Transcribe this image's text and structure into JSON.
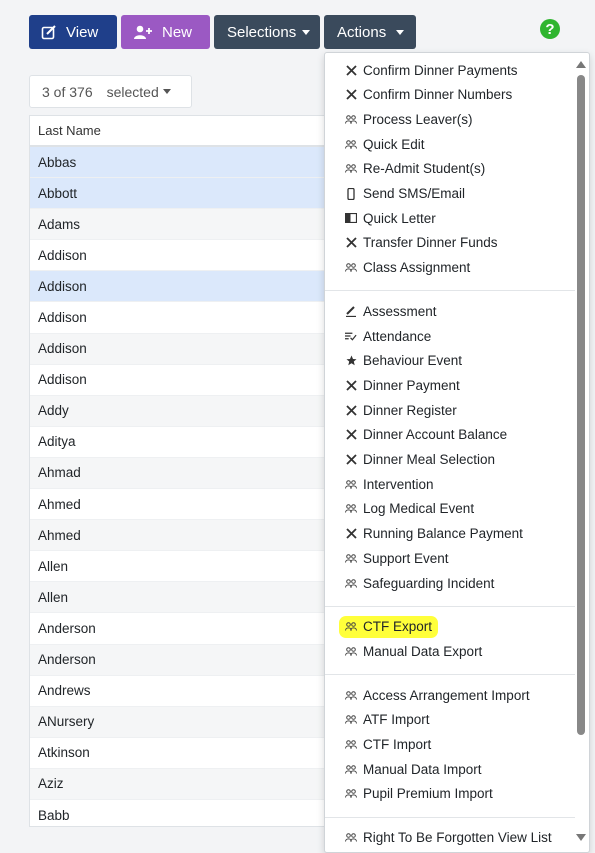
{
  "toolbar": {
    "view_label": "View",
    "new_label": "New",
    "selections_label": "Selections",
    "actions_label": "Actions",
    "help_label": "?"
  },
  "selection": {
    "count": "3 of 376",
    "word": "selected"
  },
  "table": {
    "header": "Last Name",
    "rows": [
      {
        "name": "Abbas",
        "selected": true
      },
      {
        "name": "Abbott",
        "selected": true
      },
      {
        "name": "Adams",
        "selected": false
      },
      {
        "name": "Addison",
        "selected": false
      },
      {
        "name": "Addison",
        "selected": true
      },
      {
        "name": "Addison",
        "selected": false
      },
      {
        "name": "Addison",
        "selected": false
      },
      {
        "name": "Addison",
        "selected": false
      },
      {
        "name": "Addy",
        "selected": false
      },
      {
        "name": "Aditya",
        "selected": false
      },
      {
        "name": "Ahmad",
        "selected": false
      },
      {
        "name": "Ahmed",
        "selected": false
      },
      {
        "name": "Ahmed",
        "selected": false
      },
      {
        "name": "Allen",
        "selected": false
      },
      {
        "name": "Allen",
        "selected": false
      },
      {
        "name": "Anderson",
        "selected": false
      },
      {
        "name": "Anderson",
        "selected": false
      },
      {
        "name": "Andrews",
        "selected": false
      },
      {
        "name": "ANursery",
        "selected": false
      },
      {
        "name": "Atkinson",
        "selected": false
      },
      {
        "name": "Aziz",
        "selected": false
      },
      {
        "name": "Babb",
        "selected": false
      }
    ]
  },
  "actions_menu": {
    "groups": [
      [
        {
          "label": "Confirm Dinner Payments",
          "icon": "cutlery-icon"
        },
        {
          "label": "Confirm Dinner Numbers",
          "icon": "cutlery-icon"
        },
        {
          "label": "Process Leaver(s)",
          "icon": "users-icon"
        },
        {
          "label": "Quick Edit",
          "icon": "users-icon"
        },
        {
          "label": "Re-Admit Student(s)",
          "icon": "users-icon"
        },
        {
          "label": "Send SMS/Email",
          "icon": "phone-icon"
        },
        {
          "label": "Quick Letter",
          "icon": "letter-icon"
        },
        {
          "label": "Transfer Dinner Funds",
          "icon": "cutlery-icon"
        },
        {
          "label": "Class Assignment",
          "icon": "users-icon"
        }
      ],
      [
        {
          "label": "Assessment",
          "icon": "pen-icon"
        },
        {
          "label": "Attendance",
          "icon": "checklist-icon"
        },
        {
          "label": "Behaviour Event",
          "icon": "star-icon"
        },
        {
          "label": "Dinner Payment",
          "icon": "cutlery-icon"
        },
        {
          "label": "Dinner Register",
          "icon": "cutlery-icon"
        },
        {
          "label": "Dinner Account Balance",
          "icon": "cutlery-icon"
        },
        {
          "label": "Dinner Meal Selection",
          "icon": "cutlery-icon"
        },
        {
          "label": "Intervention",
          "icon": "users-icon"
        },
        {
          "label": "Log Medical Event",
          "icon": "users-icon"
        },
        {
          "label": "Running Balance Payment",
          "icon": "cutlery-icon"
        },
        {
          "label": "Support Event",
          "icon": "users-icon"
        },
        {
          "label": "Safeguarding Incident",
          "icon": "users-icon"
        }
      ],
      [
        {
          "label": "CTF Export",
          "icon": "users-icon",
          "highlighted": true
        },
        {
          "label": "Manual Data Export",
          "icon": "users-icon"
        }
      ],
      [
        {
          "label": "Access Arrangement Import",
          "icon": "users-icon"
        },
        {
          "label": "ATF Import",
          "icon": "users-icon"
        },
        {
          "label": "CTF Import",
          "icon": "users-icon"
        },
        {
          "label": "Manual Data Import",
          "icon": "users-icon"
        },
        {
          "label": "Pupil Premium Import",
          "icon": "users-icon"
        }
      ],
      [
        {
          "label": "Right To Be Forgotten View List",
          "icon": "users-icon"
        }
      ]
    ]
  },
  "colors": {
    "view_button": "#1f3f8a",
    "new_button": "#9b59c3",
    "dark_button": "#3a4a5c",
    "help": "#2fb52f",
    "row_selected": "#dbe8fb",
    "highlight": "#ffff3a"
  }
}
